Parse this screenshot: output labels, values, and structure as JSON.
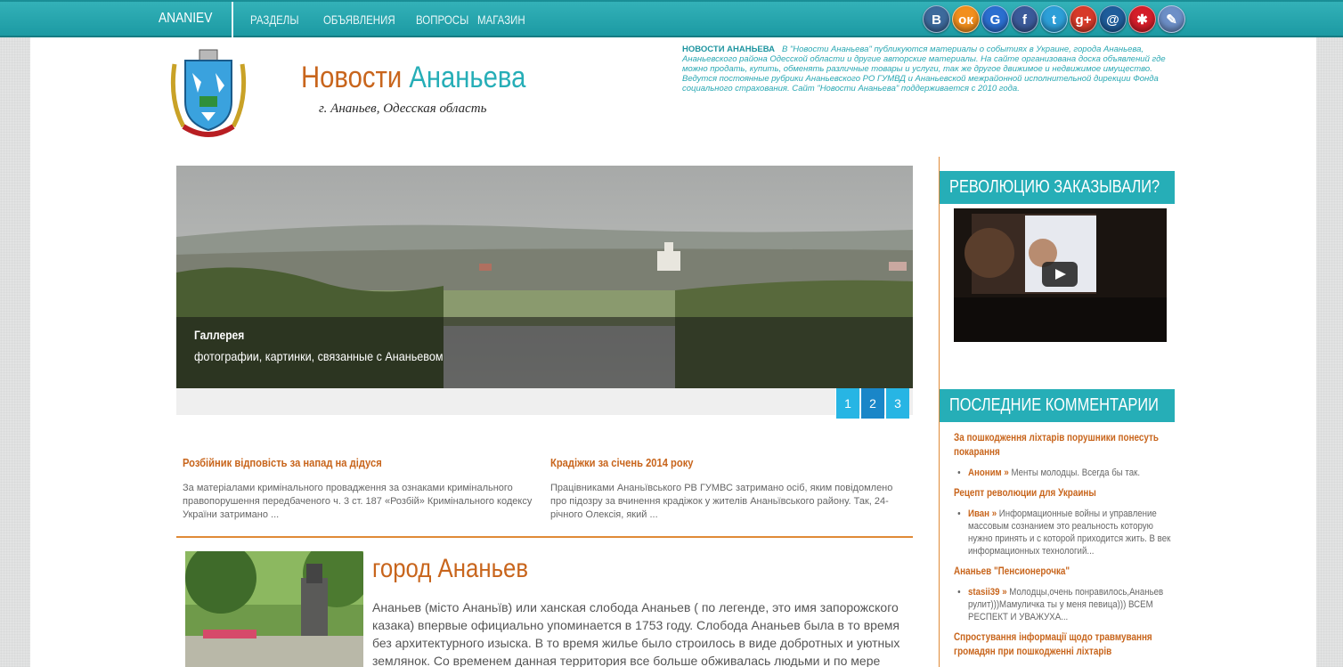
{
  "topbar": {
    "brand": "ANANIEV",
    "nav": [
      "РАЗДЕЛЫ",
      "ОБЪЯВЛЕНИЯ",
      "ВОПРОСЫ",
      "МАГАЗИН"
    ],
    "social": [
      {
        "name": "vkontakte-icon",
        "glyph": "В",
        "color": "#3d6a9c"
      },
      {
        "name": "odnoklassniki-icon",
        "glyph": "ок",
        "color": "#f28f1d"
      },
      {
        "name": "google-icon",
        "glyph": "G",
        "color": "#2b6fd0"
      },
      {
        "name": "facebook-icon",
        "glyph": "f",
        "color": "#3b5a9a"
      },
      {
        "name": "twitter-icon",
        "glyph": "t",
        "color": "#2d9fd8"
      },
      {
        "name": "google-plus-icon",
        "glyph": "g+",
        "color": "#d73a2a"
      },
      {
        "name": "mail-icon",
        "glyph": "@",
        "color": "#1f5d9b"
      },
      {
        "name": "livejournal-icon",
        "glyph": "✱",
        "color": "#d41e2a"
      },
      {
        "name": "blog-icon",
        "glyph": "✎",
        "color": "#6d8fc7"
      }
    ]
  },
  "header": {
    "title_part1": "Новости",
    "title_part2": "Ананьева",
    "subtitle": "г. Ананьев, Одесская область",
    "about_label": "НОВОСТИ АНАНЬЕВА",
    "about_text": "В \"Новости Ананьева\" публикуются материалы о событиях в Украине, города Ананьева, Ананьевского района Одесской области и другие авторские материалы. На сайте организована доска объявлений где можно продать, купить, обменять различные товары и услуги, так же другое движимое и недвижимое имущество. Ведутся постоянные рубрики Ананьевского РО ГУМВД и Ананьевской межрайонной исполнительной дирекции Фонда социального страхования. Сайт \"Новости Ананьева\" поддерживается с 2010 года."
  },
  "slider": {
    "caption_title": "Галлерея",
    "caption_desc": "фотографии, картинки, связанные с Ананьевом",
    "pages": [
      "1",
      "2",
      "3"
    ],
    "active_page": "2"
  },
  "news": [
    {
      "title": "Розбійник відповість за напад на дідуся",
      "excerpt": "За матеріалами кримінального провадження за ознаками кримінального правопорушення передбаченого ч. 3 ст. 187 «Розбій» Кримінального кодексу України затримано ..."
    },
    {
      "title": "Крадіжки за січень 2014 року",
      "excerpt": "Працівниками Ананьївського РВ ГУМВС затримано осіб, яким повідомлено про підозру за вчинення крадіжок у жителів Ананьївського району. Так,  24-річного Олексія, який ..."
    }
  ],
  "article": {
    "title": "город Ананьев",
    "text": "Ананьев (місто Ананьїв) или ханская слобода Ананьев ( по легенде, это имя запорожского казака) впервые официально упоминается в 1753 году. Слобода Ананьев была в то время без архитектурного изыска. В то время жилье было строилось в виде добротных и уютных землянок. Со временем данная территория все больше обживалась людьми и по мере развития торговли слобода стала"
  },
  "sidebar": {
    "video_heading": "РЕВОЛЮЦИЮ ЗАКАЗЫВАЛИ?",
    "comments_heading": "ПОСЛЕДНИЕ КОММЕНТАРИИ",
    "comments": [
      {
        "topic": "За пошкодження ліхтарів порушники понесуть покарання",
        "author": "Аноним »",
        "text": "Менты молодцы. Всегда бы так."
      },
      {
        "topic": "Рецепт революции для Украины",
        "author": "Иван »",
        "text": "Информационные войны и управление массовым сознанием это реальность которую нужно принять и с которой приходится жить. В век информационных технологий..."
      },
      {
        "topic": "Ананьев \"Пенсионерочка\"",
        "author": "stasii39 »",
        "text": "Молодцы,очень понравилось,Ананьев рулит)))Мамуличка ты у меня певица))) ВСЕМ РЕСПЕКТ И УВАЖУХА..."
      },
      {
        "topic": "Спростування інформації щодо травмування громадян при пошкодженні ліхтарів",
        "author": "",
        "text": ""
      }
    ]
  }
}
